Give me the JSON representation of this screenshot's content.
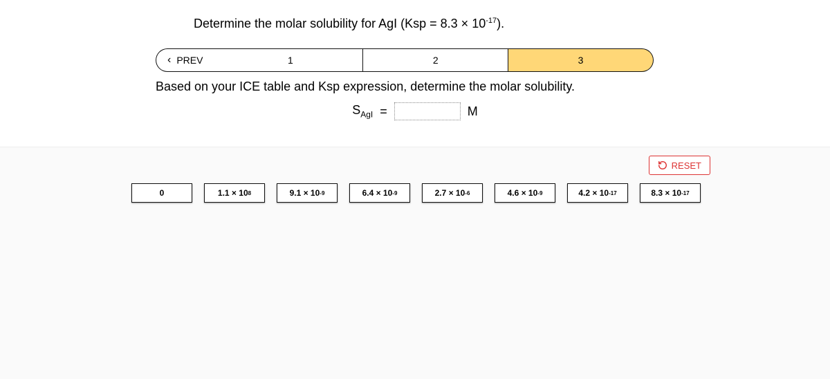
{
  "question_html": "Determine the molar solubility for AgI (Ksp = 8.3 × 10<sup>-17</sup>).",
  "prev_label": "PREV",
  "steps": [
    "1",
    "2",
    "3"
  ],
  "active_step_index": 2,
  "instruction": "Based on your ICE table and Ksp expression, determine the molar solubility.",
  "equation": {
    "lhs_html": "S<span class=\"sub\">AgI</span>",
    "eq": "=",
    "unit": "M"
  },
  "reset_label": "RESET",
  "tiles_html": [
    "0",
    "1.1 × 10<sup>8</sup>",
    "9.1 × 10<sup>-9</sup>",
    "6.4 × 10<sup>-9</sup>",
    "2.7 × 10<sup>-6</sup>",
    "4.6 × 10<sup>-9</sup>",
    "4.2 × 10<sup>-17</sup>",
    "8.3 × 10<sup>-17</sup>"
  ]
}
